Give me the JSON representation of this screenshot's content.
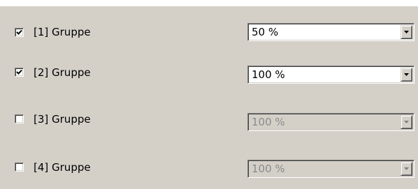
{
  "groups": [
    {
      "label": "[1] Gruppe",
      "checked": true,
      "value": "50 %",
      "enabled": true
    },
    {
      "label": "[2] Gruppe",
      "checked": true,
      "value": "100 %",
      "enabled": true
    },
    {
      "label": "[3] Gruppe",
      "checked": false,
      "value": "100 %",
      "enabled": false
    },
    {
      "label": "[4] Gruppe",
      "checked": false,
      "value": "100 %",
      "enabled": false
    }
  ],
  "icons": {
    "checkbox_mark": "checkmark-icon",
    "dropdown_arrow": "chevron-down-icon"
  }
}
